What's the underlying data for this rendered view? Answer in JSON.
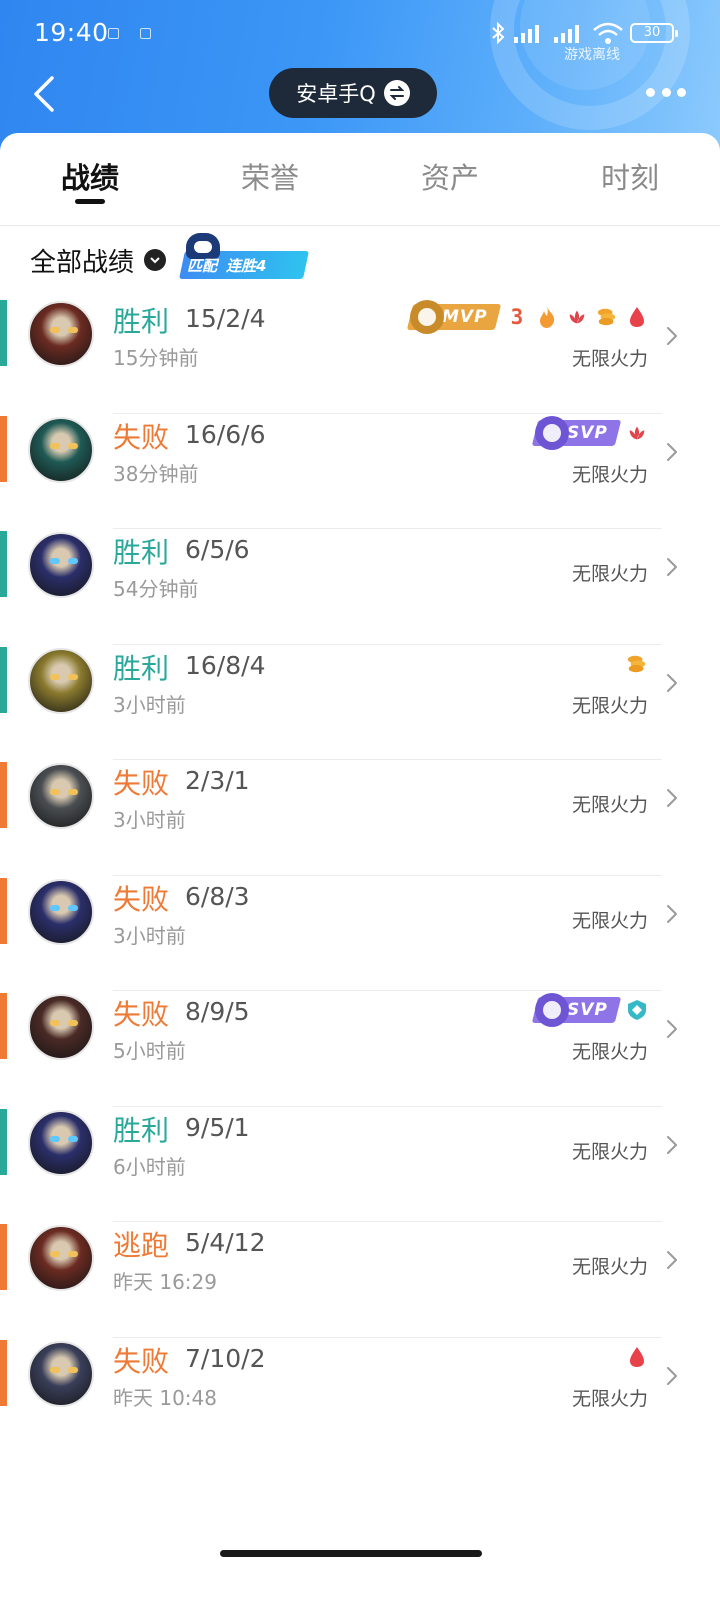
{
  "status_bar": {
    "time": "19:40",
    "battery": "30",
    "game_status": "游戏离线"
  },
  "header": {
    "account": "安卓手Q"
  },
  "tabs": [
    {
      "label": "战绩",
      "active": true
    },
    {
      "label": "荣誉",
      "active": false
    },
    {
      "label": "资产",
      "active": false
    },
    {
      "label": "时刻",
      "active": false
    }
  ],
  "filter": {
    "label": "全部战绩",
    "streak_type": "匹配",
    "streak_text": "连胜4"
  },
  "colors": {
    "win": "#2aa89a",
    "loss": "#ee7a36",
    "mvp_gold": "#e9a640",
    "svp_purple": "#8e74e6"
  },
  "matches": [
    {
      "result": "胜利",
      "outcome": "win",
      "kda": "15/2/4",
      "time": "15分钟前",
      "mode": "无限火力",
      "medal": "MVP",
      "icons": [
        "triple-kill-icon",
        "fire-icon",
        "lotus-icon",
        "coins-icon",
        "blood-drop-icon"
      ],
      "avatar": "#6b2b22"
    },
    {
      "result": "失败",
      "outcome": "loss",
      "kda": "16/6/6",
      "time": "38分钟前",
      "mode": "无限火力",
      "medal": "SVP",
      "icons": [
        "lotus-icon"
      ],
      "avatar": "#1f5a55"
    },
    {
      "result": "胜利",
      "outcome": "win",
      "kda": "6/5/6",
      "time": "54分钟前",
      "mode": "无限火力",
      "medal": "",
      "icons": [],
      "avatar": "#2b2f6a"
    },
    {
      "result": "胜利",
      "outcome": "win",
      "kda": "16/8/4",
      "time": "3小时前",
      "mode": "无限火力",
      "medal": "",
      "icons": [
        "coins-icon"
      ],
      "avatar": "#8a7a2e"
    },
    {
      "result": "失败",
      "outcome": "loss",
      "kda": "2/3/1",
      "time": "3小时前",
      "mode": "无限火力",
      "medal": "",
      "icons": [],
      "avatar": "#4a4e52"
    },
    {
      "result": "失败",
      "outcome": "loss",
      "kda": "6/8/3",
      "time": "3小时前",
      "mode": "无限火力",
      "medal": "",
      "icons": [],
      "avatar": "#2b2f6a"
    },
    {
      "result": "失败",
      "outcome": "loss",
      "kda": "8/9/5",
      "time": "5小时前",
      "mode": "无限火力",
      "medal": "SVP",
      "icons": [
        "shield-icon"
      ],
      "avatar": "#4a2a26"
    },
    {
      "result": "胜利",
      "outcome": "win",
      "kda": "9/5/1",
      "time": "6小时前",
      "mode": "无限火力",
      "medal": "",
      "icons": [],
      "avatar": "#2b2f6a"
    },
    {
      "result": "逃跑",
      "outcome": "loss",
      "kda": "5/4/12",
      "time": "昨天 16:29",
      "mode": "无限火力",
      "medal": "",
      "icons": [],
      "avatar": "#6b2b22"
    },
    {
      "result": "失败",
      "outcome": "loss",
      "kda": "7/10/2",
      "time": "昨天 10:48",
      "mode": "无限火力",
      "medal": "",
      "icons": [
        "blood-drop-icon"
      ],
      "avatar": "#3a3f5a"
    }
  ]
}
